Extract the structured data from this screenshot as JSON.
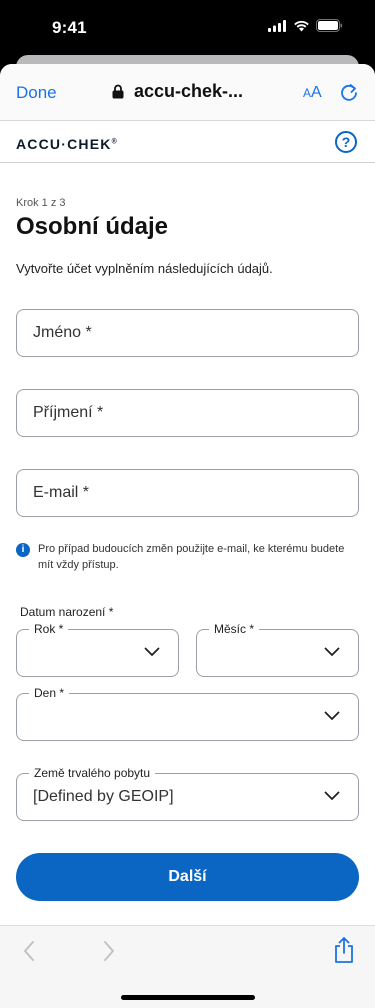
{
  "status": {
    "time": "9:41"
  },
  "browser": {
    "done_label": "Done",
    "url": "accu-chek-...",
    "aa_big": "A",
    "aa_small": "A"
  },
  "header": {
    "logo": "ACCU·CHEK",
    "logo_mark": "®",
    "help": "?"
  },
  "form": {
    "step": "Krok 1 z 3",
    "title": "Osobní údaje",
    "subtitle": "Vytvořte účet vyplněním následujících údajů.",
    "first_name": "Jméno *",
    "last_name": "Příjmení *",
    "email": "E-mail *",
    "info_icon": "i",
    "info_text": "Pro případ budoucích změn použijte e-mail, ke kterému budete mít vždy přístup.",
    "dob_label": "Datum narození *",
    "year_label": "Rok *",
    "month_label": "Měsíc *",
    "day_label": "Den *",
    "country_label": "Země trvalého pobytu",
    "country_value": "[Defined by GEOIP]",
    "next_button": "Další"
  },
  "colors": {
    "accent": "#0a66c2",
    "link": "#1a73e8"
  }
}
